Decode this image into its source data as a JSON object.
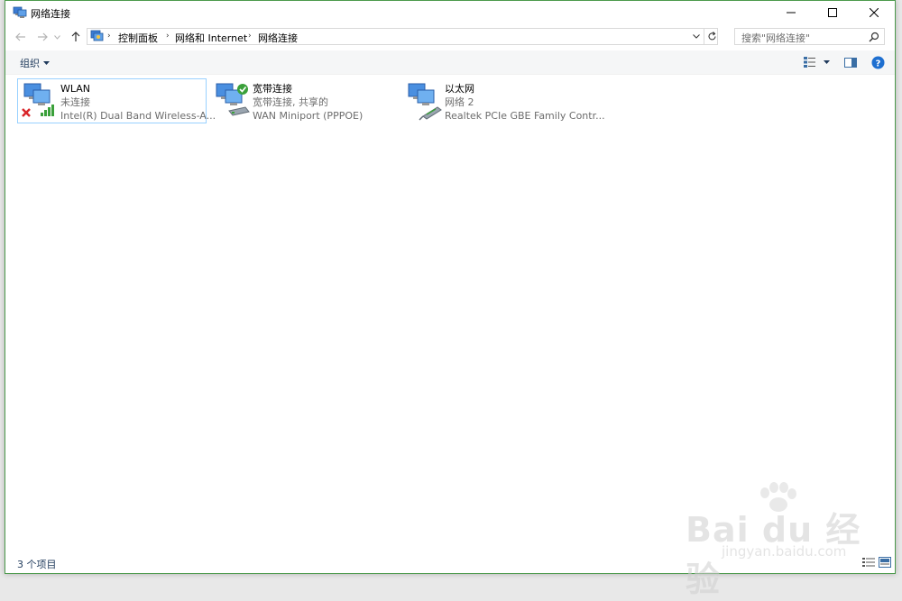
{
  "window": {
    "title": "网络连接"
  },
  "address": {
    "crumbs": [
      "控制面板",
      "网络和 Internet",
      "网络连接"
    ]
  },
  "search": {
    "placeholder": "搜索\"网络连接\""
  },
  "toolbar": {
    "organize_label": "组织"
  },
  "connections": [
    {
      "name": "WLAN",
      "status": "未连接",
      "device": "Intel(R) Dual Band Wireless-A...",
      "type": "wireless",
      "state": "disconnected"
    },
    {
      "name": "宽带连接",
      "status": "宽带连接, 共享的",
      "device": "WAN Miniport (PPPOE)",
      "type": "broadband",
      "state": "connected"
    },
    {
      "name": "以太网",
      "status": "网络  2",
      "device": "Realtek PCIe GBE Family Contr...",
      "type": "ethernet",
      "state": "connected"
    }
  ],
  "statusbar": {
    "item_count": "3 个项目"
  },
  "watermark": {
    "logo": "Bai du 经验",
    "url": "jingyan.baidu.com"
  },
  "colors": {
    "accent": "#1e395b",
    "selection_border": "#99d1ff",
    "window_border": "#4c9a4c"
  }
}
